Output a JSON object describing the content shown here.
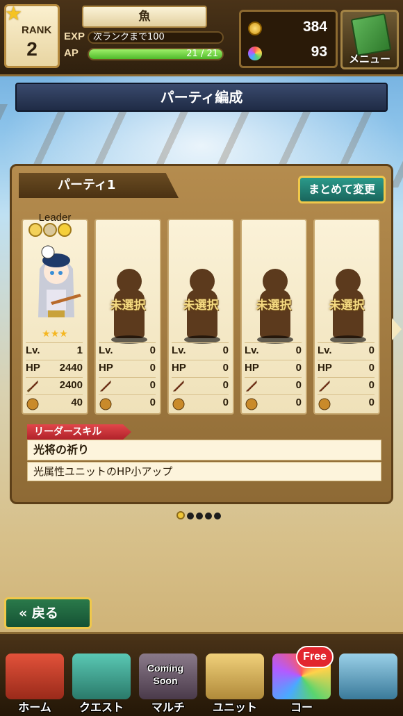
{
  "hud": {
    "rank_label": "RANK",
    "rank_value": "2",
    "player_name": "魚",
    "exp_label": "EXP",
    "exp_text": "次ランクまで100",
    "exp_fill": 0.0,
    "ap_label": "AP",
    "ap_text": "21 / 21",
    "ap_fill": 1.0,
    "coins": "384",
    "moons": "93",
    "menu_label": "メニュー"
  },
  "title": "パーティ編成",
  "party": {
    "tab_label": "パーティ1",
    "bulk_change_label": "まとめて変更",
    "leader_label": "Leader",
    "unselected_label": "未選択",
    "stat_labels": {
      "lv": "Lv.",
      "hp": "HP"
    },
    "slots": [
      {
        "lv": "1",
        "hp": "2440",
        "atk": "2400",
        "cost": "40",
        "stars": "★★★",
        "filled": true
      },
      {
        "lv": "0",
        "hp": "0",
        "atk": "0",
        "cost": "0",
        "filled": false
      },
      {
        "lv": "0",
        "hp": "0",
        "atk": "0",
        "cost": "0",
        "filled": false
      },
      {
        "lv": "0",
        "hp": "0",
        "atk": "0",
        "cost": "0",
        "filled": false
      },
      {
        "lv": "0",
        "hp": "0",
        "atk": "0",
        "cost": "0",
        "filled": false
      }
    ],
    "leader_skill_tag": "リーダースキル",
    "leader_skill_name": "光将の祈り",
    "leader_skill_desc": "光属性ユニットのHP小アップ"
  },
  "pager": {
    "page_count": 5,
    "active_index": 0
  },
  "back_label": "戻る",
  "nav": {
    "items": [
      "ホーム",
      "クエスト",
      "マルチ",
      "ユニット",
      "コー"
    ],
    "coming_soon": "Coming Soon",
    "free_badge": "Free"
  },
  "colors": {
    "accent_gold": "#f0c84a",
    "ap_green": "#4fb92a",
    "skill_red": "#d0343a"
  }
}
